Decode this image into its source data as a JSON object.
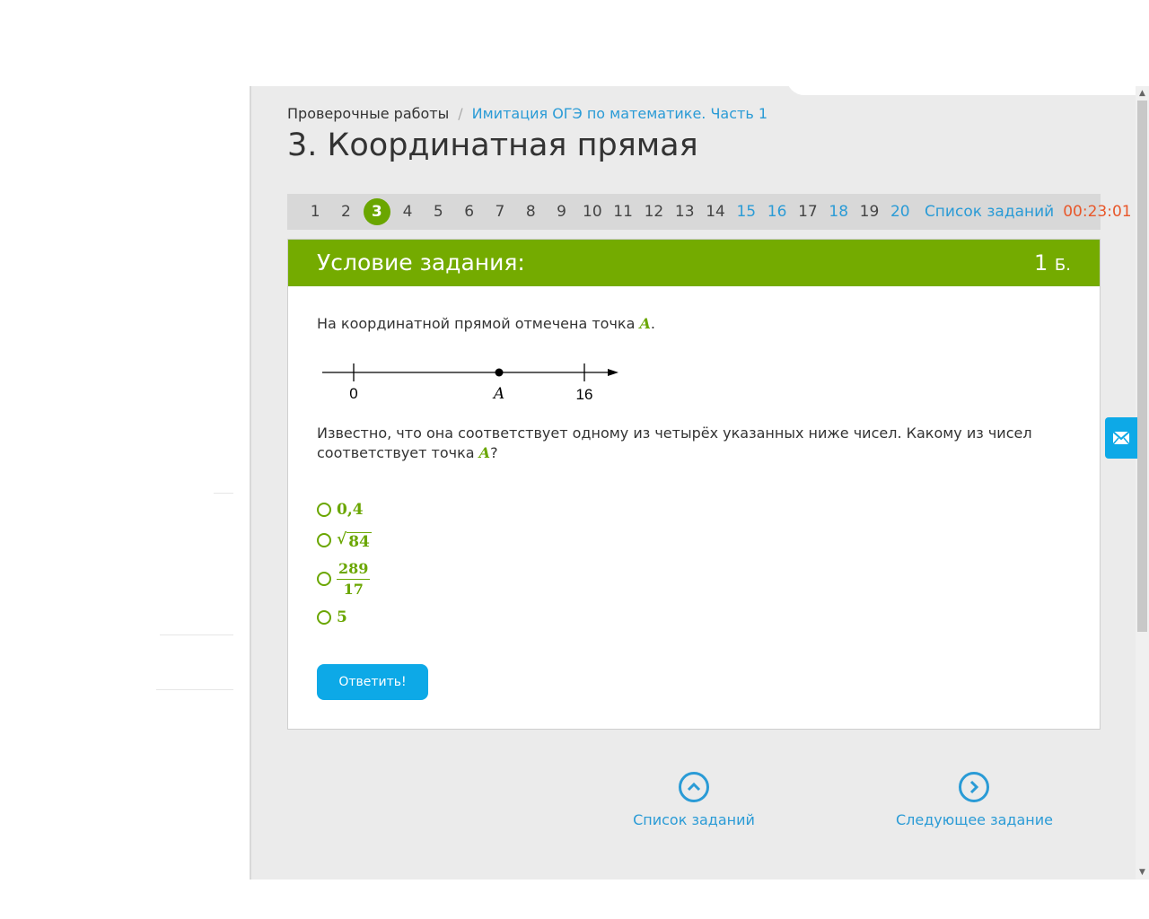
{
  "breadcrumb": {
    "home": "Проверочные работы",
    "separator": "/",
    "current": "Имитация ОГЭ по математике. Часть 1"
  },
  "page_title": "3. Координатная прямая",
  "task_nav": {
    "items": [
      {
        "label": "1",
        "state": "normal"
      },
      {
        "label": "2",
        "state": "normal"
      },
      {
        "label": "3",
        "state": "current"
      },
      {
        "label": "4",
        "state": "normal"
      },
      {
        "label": "5",
        "state": "normal"
      },
      {
        "label": "6",
        "state": "normal"
      },
      {
        "label": "7",
        "state": "normal"
      },
      {
        "label": "8",
        "state": "normal"
      },
      {
        "label": "9",
        "state": "normal"
      },
      {
        "label": "10",
        "state": "normal"
      },
      {
        "label": "11",
        "state": "normal"
      },
      {
        "label": "12",
        "state": "normal"
      },
      {
        "label": "13",
        "state": "normal"
      },
      {
        "label": "14",
        "state": "normal"
      },
      {
        "label": "15",
        "state": "done"
      },
      {
        "label": "16",
        "state": "done"
      },
      {
        "label": "17",
        "state": "normal"
      },
      {
        "label": "18",
        "state": "done"
      },
      {
        "label": "19",
        "state": "normal"
      },
      {
        "label": "20",
        "state": "done"
      }
    ],
    "list_link": "Список заданий",
    "timer": "00:23:01"
  },
  "card": {
    "header_title": "Условие задания:",
    "points_value": "1",
    "points_unit": "Б.",
    "question_intro": "На координатной прямой отмечена точка ",
    "point_name": "A",
    "intro_end": ".",
    "number_line": {
      "label_zero": "0",
      "label_point": "A",
      "label_end": "16"
    },
    "question_body": "Известно, что она соответствует одному из четырёх указанных ниже чисел. Какому из чисел соответствует точка ",
    "question_end": "?",
    "options": {
      "opt1": "0,4",
      "opt2_radicand": "84",
      "opt3_num": "289",
      "opt3_den": "17",
      "opt4": "5"
    },
    "submit_label": "Ответить!"
  },
  "bottom_nav": {
    "list_label": "Список заданий",
    "next_label": "Следующее задание"
  },
  "colors": {
    "accent_green": "#74ab00",
    "link_blue": "#2a9bd6",
    "timer_red": "#e8572a",
    "button_blue": "#0da9e7"
  }
}
